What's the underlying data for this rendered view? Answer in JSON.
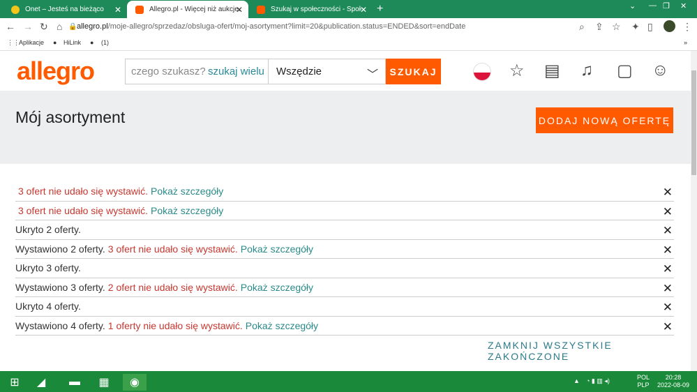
{
  "tabs": [
    {
      "title": "Onet – Jesteś na bieżąco",
      "color": "#f5c518"
    },
    {
      "title": "Allegro.pl - Więcej niż aukcje. Na",
      "color": "#ff5a00"
    },
    {
      "title": "Szukaj w społeczności - Społecz",
      "color": "#ff5a00"
    }
  ],
  "browser": {
    "url_host": "allegro.pl",
    "url_rest": "/moje-allegro/sprzedaz/obsluga-ofert/moj-asortyment?limit=20&publication.status=ENDED&sort=endDate",
    "bookmarks": [
      "Aplikacje",
      "HiLink",
      "(1)"
    ]
  },
  "header": {
    "logo": "allegro",
    "search_placeholder": "czego szukasz?",
    "search_sub": "szukaj wielu",
    "category": "Wszędzie",
    "search_button": "SZUKAJ"
  },
  "page": {
    "title": "Mój asortyment",
    "add_button": "DODAJ NOWĄ OFERTĘ",
    "close_all": "ZAMKNIJ WSZYSTKIE ZAKOŃCZONE"
  },
  "notifications": [
    {
      "black": "",
      "red": "3 ofert nie udało się wystawić.",
      "link": "Pokaż szczegóły"
    },
    {
      "black": "",
      "red": "3 ofert nie udało się wystawić.",
      "link": "Pokaż szczegóły"
    },
    {
      "black": "Ukryto 2 oferty.",
      "red": "",
      "link": ""
    },
    {
      "black": "Wystawiono 2 oferty.",
      "red": "3 ofert nie udało się wystawić.",
      "link": "Pokaż szczegóły"
    },
    {
      "black": "Ukryto 3 oferty.",
      "red": "",
      "link": ""
    },
    {
      "black": "Wystawiono 3 oferty.",
      "red": "2 ofert nie udało się wystawić.",
      "link": "Pokaż szczegóły"
    },
    {
      "black": "Ukryto 4 oferty.",
      "red": "",
      "link": ""
    },
    {
      "black": "Wystawiono 4 oferty.",
      "red": "1 oferty nie udało się wystawić.",
      "link": "Pokaż szczegóły"
    }
  ],
  "taskbar": {
    "lang1": "POL",
    "lang2": "PLP",
    "time": "20:28",
    "date": "2022-08-09"
  },
  "colors": {
    "accent": "#ff5a00",
    "link": "#2a8a8a",
    "error": "#c7372f",
    "taskbar": "#1a8a3a"
  }
}
